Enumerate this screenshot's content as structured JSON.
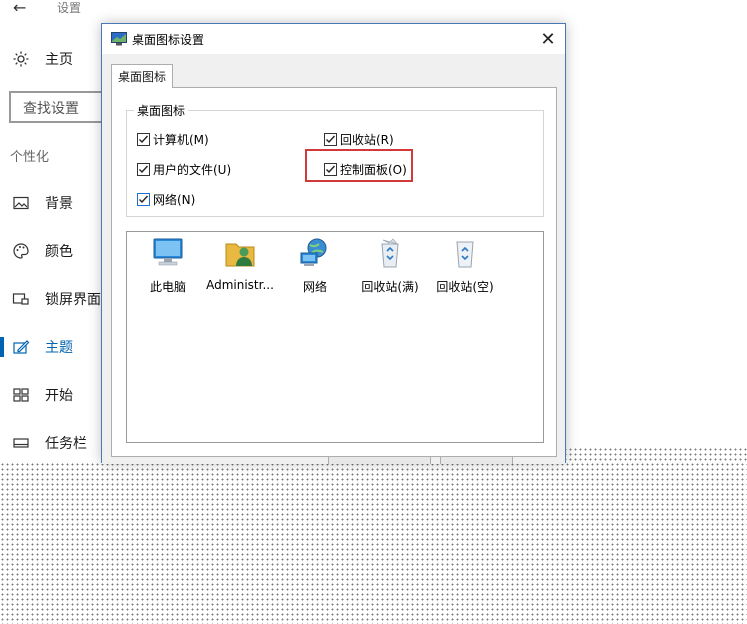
{
  "settings": {
    "title": "设置",
    "search_placeholder": "查找设置",
    "section_label": "个性化",
    "nav": [
      {
        "label": "主页",
        "icon": "gear-icon"
      },
      {
        "label": "背景",
        "icon": "image-icon"
      },
      {
        "label": "颜色",
        "icon": "palette-icon"
      },
      {
        "label": "锁屏界面",
        "icon": "lock-screen-icon"
      },
      {
        "label": "主题",
        "icon": "theme-icon",
        "active": true
      },
      {
        "label": "开始",
        "icon": "start-icon"
      },
      {
        "label": "任务栏",
        "icon": "taskbar-icon"
      }
    ]
  },
  "dialog": {
    "title": "桌面图标设置",
    "tab": "桌面图标",
    "group_label": "桌面图标",
    "checkboxes": [
      {
        "label": "计算机(M)",
        "checked": true
      },
      {
        "label": "回收站(R)",
        "checked": true
      },
      {
        "label": "用户的文件(U)",
        "checked": true
      },
      {
        "label": "控制面板(O)",
        "checked": true
      },
      {
        "label": "网络(N)",
        "checked": true
      }
    ],
    "icons": [
      {
        "label": "此电脑",
        "icon": "computer-icon"
      },
      {
        "label": "Administr...",
        "icon": "user-folder-icon"
      },
      {
        "label": "网络",
        "icon": "network-icon"
      },
      {
        "label": "回收站(满)",
        "icon": "recycle-bin-full-icon"
      },
      {
        "label": "回收站(空)",
        "icon": "recycle-bin-empty-icon"
      }
    ]
  },
  "colors": {
    "accent": "#0063b1",
    "highlight": "#d23a3a",
    "dialog_border": "#4a78b5"
  }
}
